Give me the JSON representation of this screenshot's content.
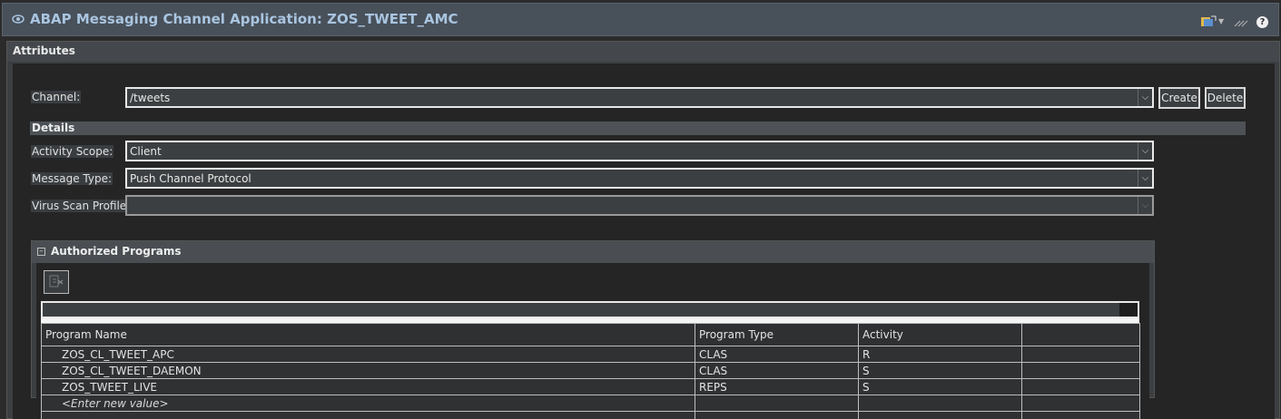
{
  "window": {
    "title": "ABAP Messaging Channel Application: ZOS_TWEET_AMC",
    "toolbar_icons": [
      "links-icon",
      "dropdown-icon",
      "edit-icon",
      "help-icon"
    ],
    "help_glyph": "?"
  },
  "attributes": {
    "header": "Attributes",
    "channel": {
      "label": "Channel:",
      "value": "/tweets",
      "create_label": "Create",
      "delete_label": "Delete"
    },
    "details": {
      "header": "Details",
      "activity_scope": {
        "label": "Activity Scope:",
        "value": "Client"
      },
      "message_type": {
        "label": "Message Type:",
        "value": "Push Channel Protocol"
      },
      "virus_scan_profile": {
        "label": "Virus Scan Profile:",
        "value": ""
      }
    }
  },
  "authorized_programs": {
    "header": "Authorized Programs",
    "columns": [
      "Program Name",
      "Program Type",
      "Activity",
      ""
    ],
    "rows": [
      {
        "name": "ZOS_CL_TWEET_APC",
        "type": "CLAS",
        "activity": "R"
      },
      {
        "name": "ZOS_CL_TWEET_DAEMON",
        "type": "CLAS",
        "activity": "S"
      },
      {
        "name": "ZOS_TWEET_LIVE",
        "type": "REPS",
        "activity": "S"
      }
    ],
    "new_value_placeholder": "<Enter new value>"
  },
  "colors": {
    "title_text": "#a9c5e0",
    "titlebar_bg": "#48505a",
    "panel_bg": "#3c3f41",
    "content_bg": "#252526"
  }
}
